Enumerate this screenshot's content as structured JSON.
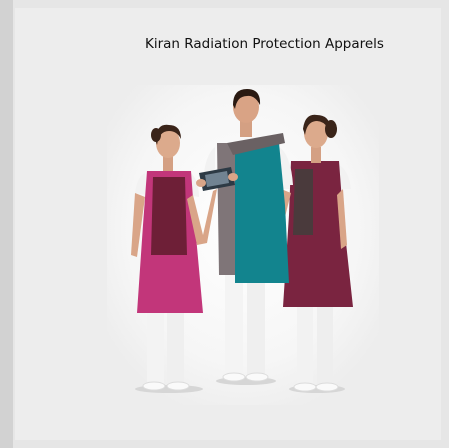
{
  "page": {
    "caption": "Kiran Radiation Protection Apparels",
    "background_color": "#e6e6e6",
    "panel_color": "#ededed"
  },
  "photo": {
    "subject": "three medical staff wearing radiation protection aprons, the middle man holding an x-ray film",
    "colors": {
      "magenta_apron": "#c2367a",
      "maroon": "#6e1f37",
      "teal_apron": "#12848e",
      "grey_panel": "#7f7578",
      "white_uniform": "#f4f4f4",
      "skin": "#d9a588",
      "hair": "#3a2419"
    }
  }
}
